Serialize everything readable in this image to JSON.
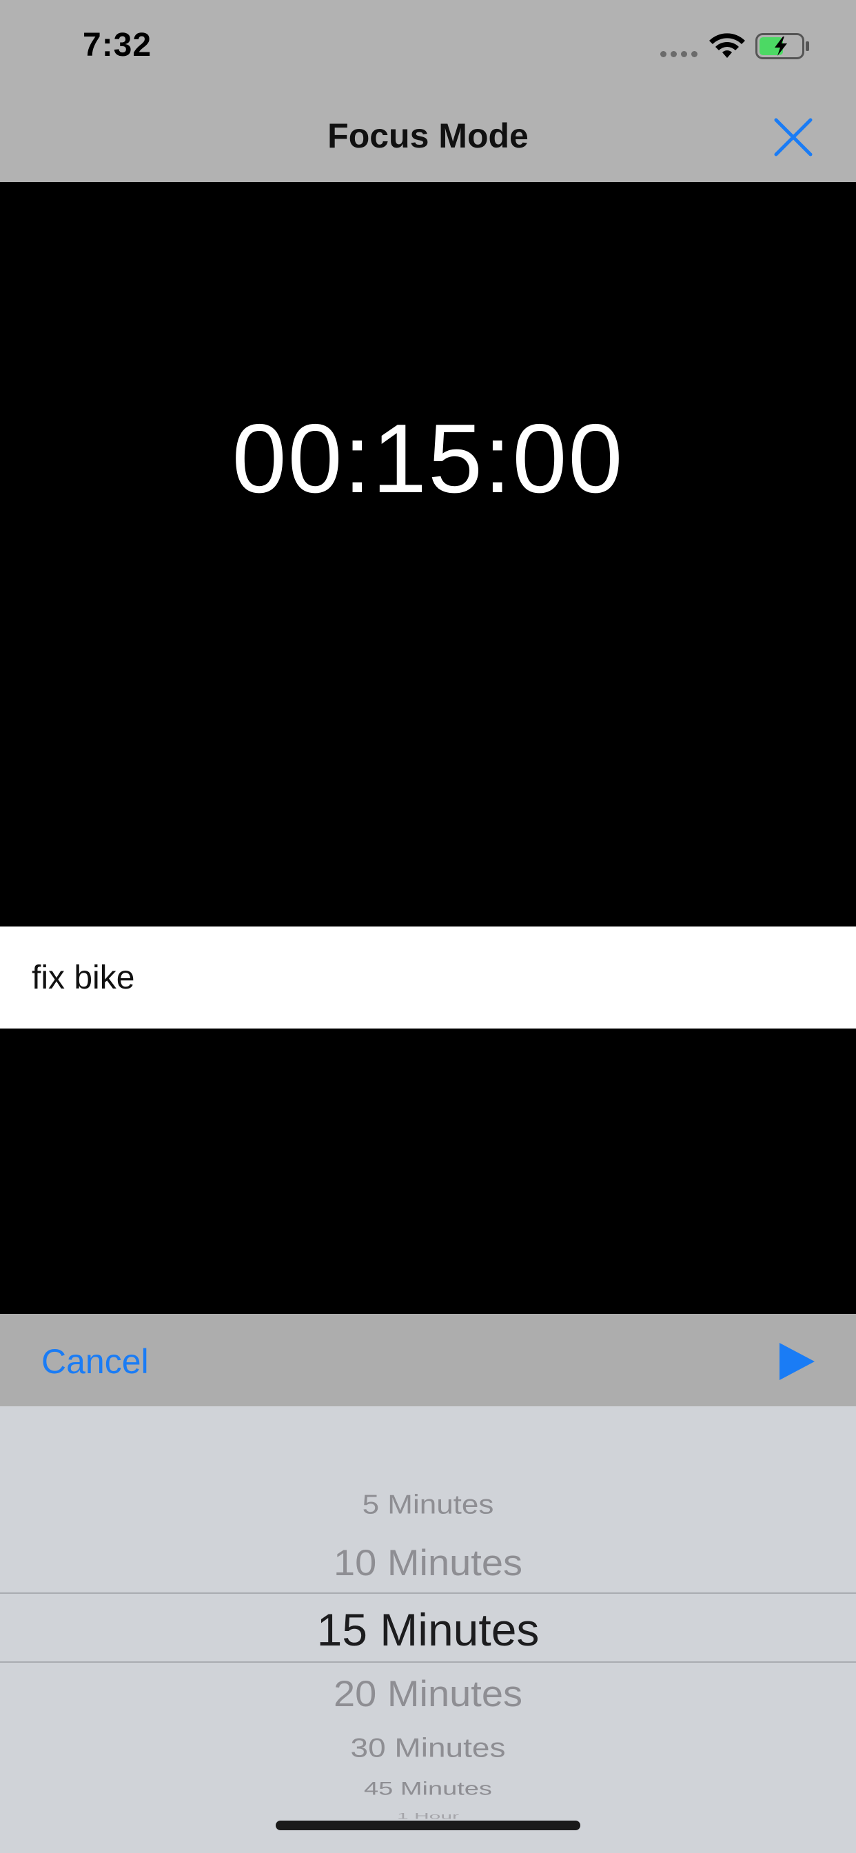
{
  "status": {
    "time": "7:32"
  },
  "nav": {
    "title": "Focus Mode"
  },
  "timer": {
    "display": "00:15:00"
  },
  "task": {
    "value": "fix bike"
  },
  "toolbar": {
    "cancel_label": "Cancel"
  },
  "picker": {
    "options": [
      "5 Minutes",
      "10 Minutes",
      "15 Minutes",
      "20 Minutes",
      "30 Minutes",
      "45 Minutes",
      "1 Hour"
    ],
    "selected": "15 Minutes"
  },
  "colors": {
    "accent": "#1a7cf5",
    "bar_gray": "#b2b2b2",
    "picker_bg": "#d0d3d8",
    "battery_green": "#4cd964"
  }
}
